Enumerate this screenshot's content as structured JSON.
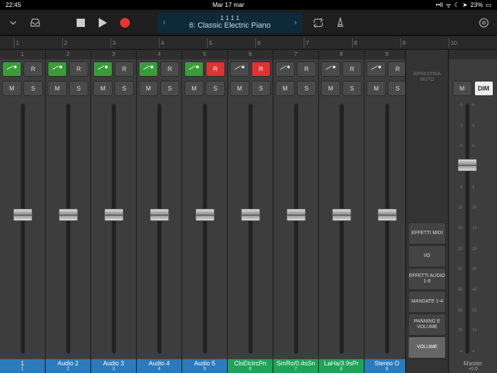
{
  "statusbar": {
    "time": "22:45",
    "date": "Mar 17 mar",
    "battery": "23%"
  },
  "toolbar": {
    "position": "1   1   1      1",
    "track": "6: Classic Electric Piano"
  },
  "ruler": [
    1,
    2,
    3,
    4,
    5,
    6,
    7,
    8,
    9,
    10
  ],
  "channels": [
    {
      "num": 1,
      "route_on": true,
      "rec_on": false,
      "label": "1",
      "sub": "1",
      "color": "#2a7bbd",
      "fader": 0.58
    },
    {
      "num": 2,
      "route_on": true,
      "rec_on": false,
      "label": "Audio 2",
      "sub": "2",
      "color": "#2a7bbd",
      "fader": 0.58
    },
    {
      "num": 3,
      "route_on": true,
      "rec_on": false,
      "label": "Audio 3",
      "sub": "3",
      "color": "#2a7bbd",
      "fader": 0.58
    },
    {
      "num": 4,
      "route_on": true,
      "rec_on": false,
      "label": "Audio 4",
      "sub": "4",
      "color": "#2a7bbd",
      "fader": 0.58
    },
    {
      "num": 5,
      "route_on": true,
      "rec_on": true,
      "label": "Audio 5",
      "sub": "5",
      "color": "#2a7bbd",
      "fader": 0.58
    },
    {
      "num": 6,
      "route_on": false,
      "rec_on": true,
      "label": "ClsElctrcPn",
      "sub": "6",
      "color": "#1fa35a",
      "fader": 0.58
    },
    {
      "num": 7,
      "route_on": false,
      "rec_on": false,
      "label": "SmRo/0.4sSn",
      "sub": "7",
      "color": "#1fa35a",
      "fader": 0.58
    },
    {
      "num": 8,
      "route_on": false,
      "rec_on": false,
      "label": "LaHa/3.9sPr",
      "sub": "8",
      "color": "#1fa35a",
      "fader": 0.58
    },
    {
      "num": 9,
      "route_on": false,
      "rec_on": false,
      "label": "Stereo O",
      "sub": "9",
      "color": "#2a7bbd",
      "fader": 0.58
    }
  ],
  "sidebar": {
    "restore": "RIPRISTINA\nMUTO",
    "items": [
      {
        "label": "EFFETTI MIDI",
        "active": false
      },
      {
        "label": "I/O",
        "active": false
      },
      {
        "label": "EFFETTI AUDIO 1-8",
        "active": false
      },
      {
        "label": "MANDATE 1-4",
        "active": false
      },
      {
        "label": "PANNING E VOLUME",
        "active": false
      },
      {
        "label": "VOLUME",
        "active": true
      }
    ]
  },
  "master": {
    "m": "M",
    "dim": "DIM",
    "scale": [
      "6",
      "3",
      "0",
      "3",
      "6",
      "10",
      "15",
      "20",
      "30",
      "40",
      "50",
      "70",
      "∞"
    ],
    "label": "Master",
    "value": "+0.0",
    "fader": 0.78
  },
  "btn": {
    "m": "M",
    "s": "S",
    "r": "R"
  }
}
